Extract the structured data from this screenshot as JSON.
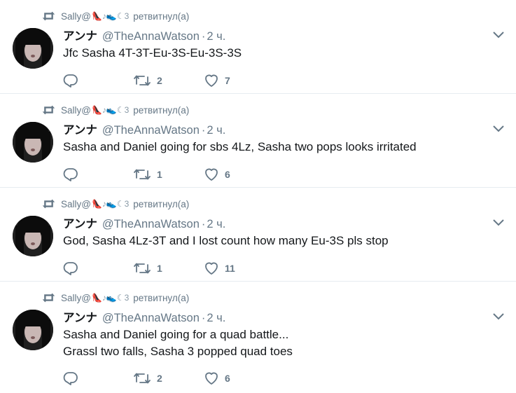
{
  "retweet_label": "ретвитнул(а)",
  "retweeter_name": "Sally@",
  "retweeter_emoji": "👠♪👟☾3",
  "author_name": "アンナ",
  "author_handle": "@TheAnnaWatson",
  "dot": "·",
  "colors": {
    "icon": "#657786",
    "border": "#e6ecf0",
    "text": "#14171a",
    "secondary": "#657786"
  },
  "tweets": [
    {
      "time": "2 ч.",
      "text_lines": [
        "Jfc Sasha 4T-3T-Eu-3S-Eu-3S-3S"
      ],
      "replies": "",
      "retweets": "2",
      "likes": "7"
    },
    {
      "time": "2 ч.",
      "text_lines": [
        "Sasha and Daniel going for sbs 4Lz, Sasha two pops looks irritated"
      ],
      "replies": "",
      "retweets": "1",
      "likes": "6"
    },
    {
      "time": "2 ч.",
      "text_lines": [
        "God, Sasha 4Lz-3T and I lost count how many Eu-3S pls stop"
      ],
      "replies": "",
      "retweets": "1",
      "likes": "11"
    },
    {
      "time": "2 ч.",
      "text_lines": [
        "Sasha and Daniel going for a quad battle...",
        "Grassl two falls, Sasha 3 popped quad toes"
      ],
      "replies": "",
      "retweets": "2",
      "likes": "6"
    }
  ]
}
